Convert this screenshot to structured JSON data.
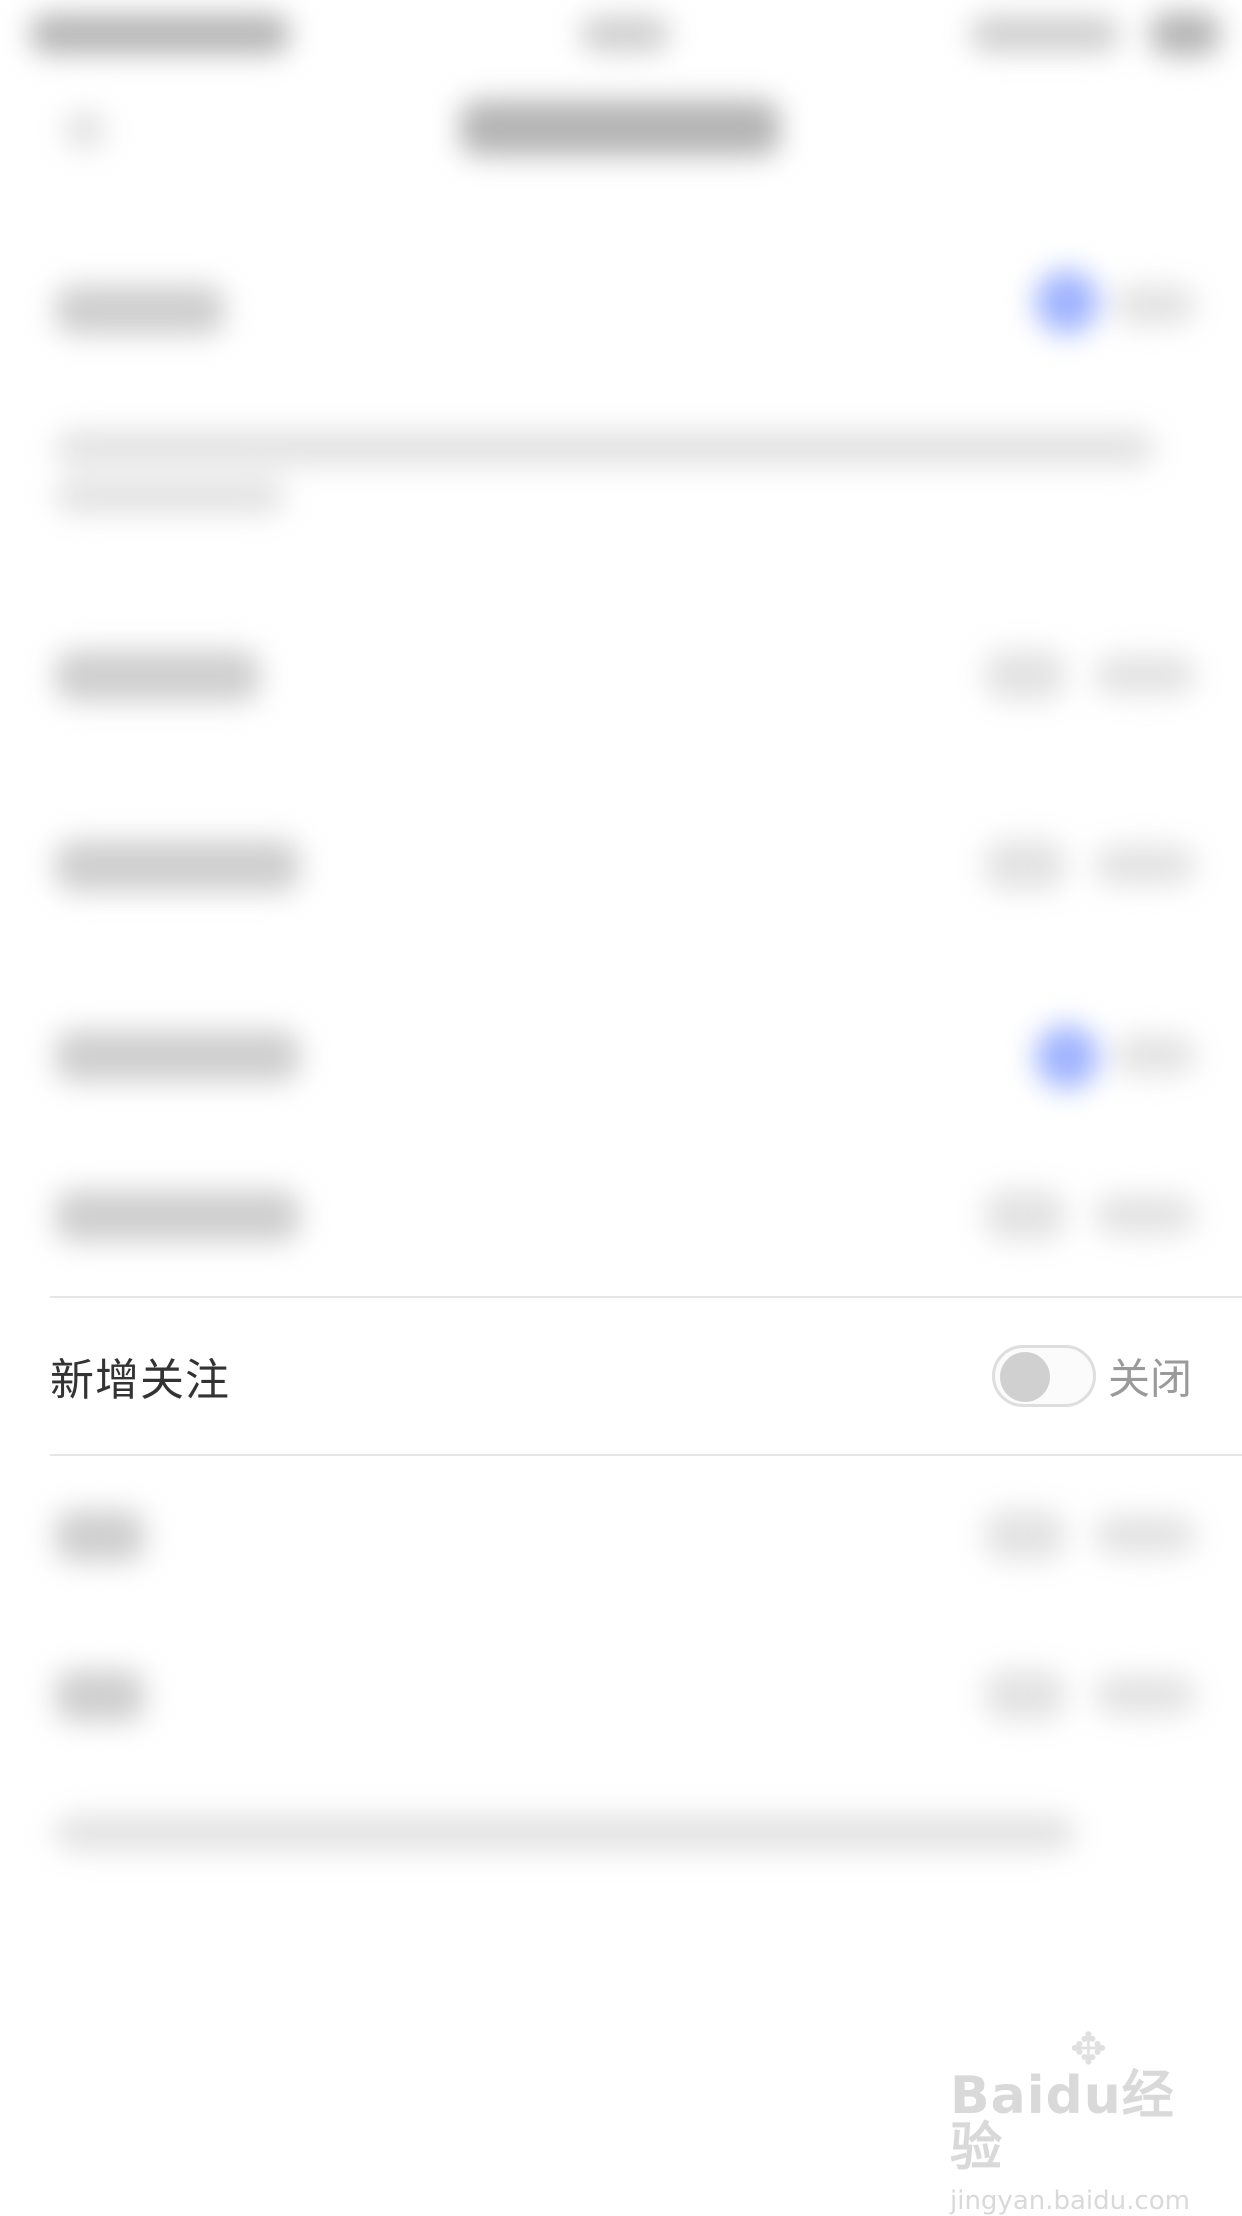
{
  "row": {
    "label": "新增关注",
    "state_label": "关闭",
    "toggle_on": false
  },
  "watermark": {
    "logo": "Baidu经验",
    "url": "jingyan.baidu.com"
  },
  "colors": {
    "accent": "#9fb3ff",
    "text": "#333333",
    "muted": "#9a9a9a",
    "divider": "#e6e6e6"
  }
}
